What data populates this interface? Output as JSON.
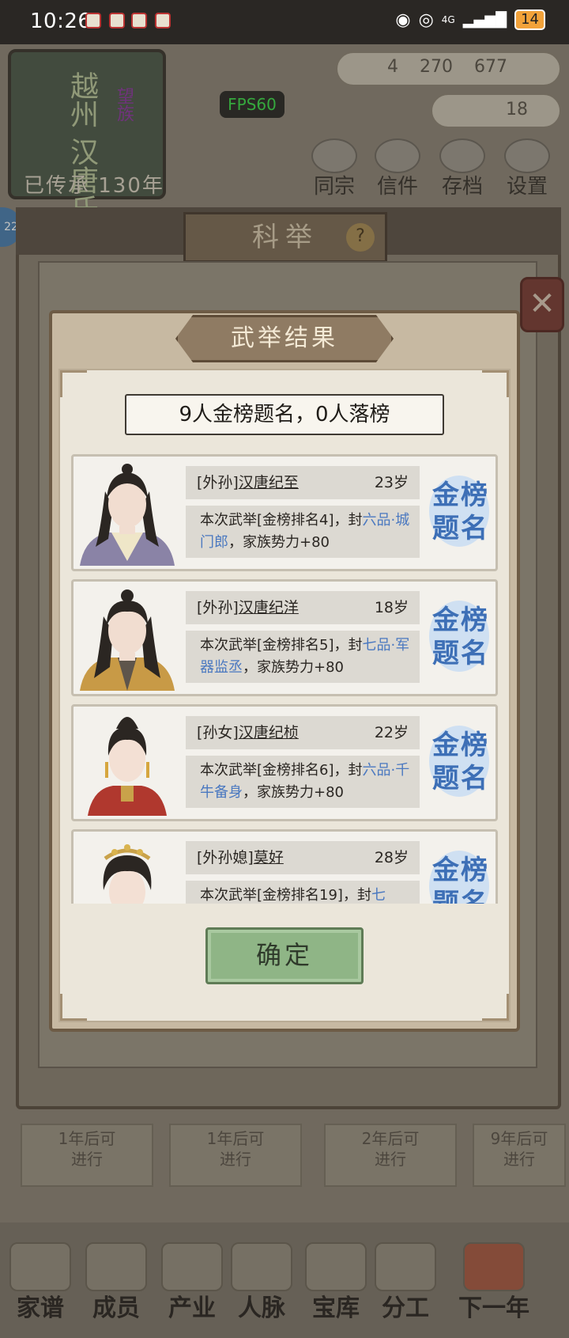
{
  "status_bar": {
    "time": "10:26",
    "network": "4G",
    "battery": "14"
  },
  "background": {
    "clan_name": "越州 汉唐氏",
    "clan_tag": "望族",
    "clan_years": "已传承 130年",
    "resources": "4 270 677",
    "resources_2": "18",
    "fps": "FPS60",
    "top_menu": [
      "同宗",
      "信件",
      "存档",
      "设置"
    ],
    "badge": "22",
    "panel_title": "科举",
    "panel_help": "?",
    "close": "✕",
    "entries": [
      "1年后可\n进行",
      "1年后可\n进行",
      "2年后可\n进行",
      "9年后可\n进行"
    ],
    "bottom_nav": [
      "家谱",
      "成员",
      "产业",
      "人脉",
      "宝库",
      "分工",
      "下一年"
    ]
  },
  "modal": {
    "title": "武举结果",
    "summary": "9人金榜题名，0人落榜",
    "confirm_label": "确定",
    "stamp_text": "金榜题名",
    "results": [
      {
        "relation": "[外孙]",
        "name": "汉唐纪至",
        "age": "23岁",
        "desc_pre": "本次武举[金榜排名4]，封",
        "desc_rank": "六品·城门郎",
        "desc_post": "，家族势力+80"
      },
      {
        "relation": "[外孙]",
        "name": "汉唐纪洋",
        "age": "18岁",
        "desc_pre": "本次武举[金榜排名5]，封",
        "desc_rank": "七品·军器监丞",
        "desc_post": "，家族势力+80"
      },
      {
        "relation": "[孙女]",
        "name": "汉唐纪桢",
        "age": "22岁",
        "desc_pre": "本次武举[金榜排名6]，封",
        "desc_rank": "六品·千牛备身",
        "desc_post": "，家族势力+80"
      },
      {
        "relation": "[外孙媳]",
        "name": "莫好",
        "age": "28岁",
        "desc_pre": "本次武举[金榜排名19]，封",
        "desc_rank": "七",
        "desc_post": ""
      }
    ]
  }
}
